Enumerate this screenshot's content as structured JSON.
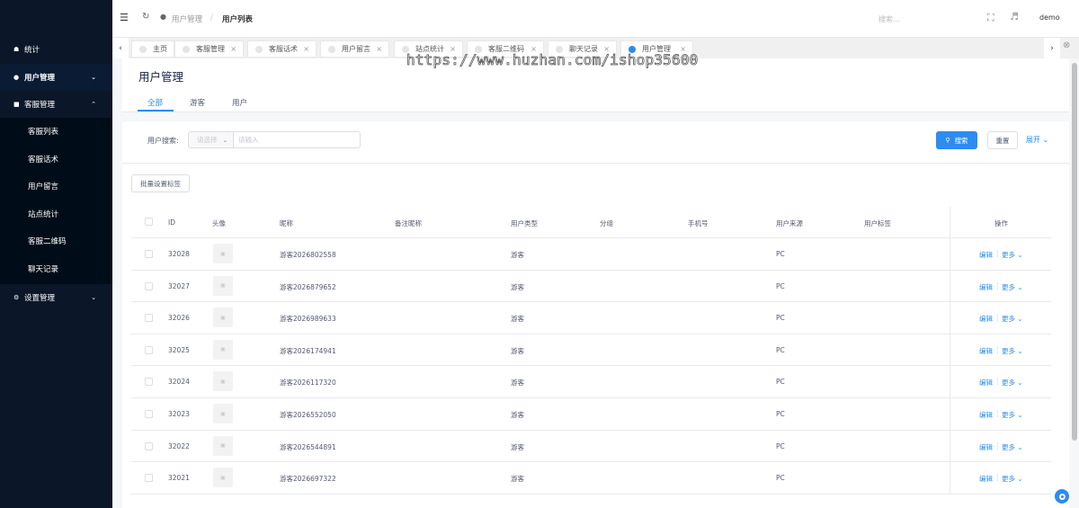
{
  "sidebar": {
    "items": [
      {
        "name": "sidebar-item-stats",
        "label": "统计",
        "icon": "home-icon"
      },
      {
        "name": "sidebar-item-users",
        "label": "用户管理",
        "icon": "user-icon"
      },
      {
        "name": "sidebar-item-service",
        "label": "客服管理",
        "icon": "chat-icon"
      }
    ],
    "sub_items": [
      "客服列表",
      "客服话术",
      "用户留言",
      "站点统计",
      "客服二维码",
      "聊天记录"
    ],
    "settings": {
      "label": "设置管理",
      "icon": "gear-icon"
    }
  },
  "header": {
    "breadcrumb_parent": "用户管理",
    "breadcrumb_sep": "/",
    "breadcrumb_current": "用户列表",
    "search_placeholder": "搜索...",
    "username": "demo"
  },
  "tabs": [
    {
      "label": "主页",
      "closable": false,
      "active": false
    },
    {
      "label": "客服管理",
      "closable": true,
      "active": false
    },
    {
      "label": "客服话术",
      "closable": true,
      "active": false
    },
    {
      "label": "用户留言",
      "closable": true,
      "active": false
    },
    {
      "label": "站点统计",
      "closable": true,
      "active": false
    },
    {
      "label": "客服二维码",
      "closable": true,
      "active": false
    },
    {
      "label": "聊天记录",
      "closable": true,
      "active": false
    },
    {
      "label": "用户管理",
      "closable": true,
      "active": true
    }
  ],
  "watermark": "https://www.huzhan.com/ishop35600",
  "page": {
    "title": "用户管理",
    "filter_tabs": [
      "全部",
      "游客",
      "用户"
    ],
    "active_filter": "全部"
  },
  "search": {
    "label": "用户搜索:",
    "select_placeholder": "请选择",
    "input_placeholder": "请输入",
    "search_button": "搜索",
    "reset_button": "重置",
    "expand": "展开"
  },
  "batch_button": "批量设置标签",
  "table": {
    "columns": [
      "ID",
      "头像",
      "昵称",
      "备注昵称",
      "用户类型",
      "分组",
      "手机号",
      "用户来源",
      "用户标签",
      "操作"
    ],
    "rows": [
      {
        "id": "32028",
        "nickname": "游客2026802558",
        "remark": "",
        "type": "游客",
        "group": "",
        "phone": "",
        "source": "PC",
        "tags": ""
      },
      {
        "id": "32027",
        "nickname": "游客2026879652",
        "remark": "",
        "type": "游客",
        "group": "",
        "phone": "",
        "source": "PC",
        "tags": ""
      },
      {
        "id": "32026",
        "nickname": "游客2026989633",
        "remark": "",
        "type": "游客",
        "group": "",
        "phone": "",
        "source": "PC",
        "tags": ""
      },
      {
        "id": "32025",
        "nickname": "游客2026174941",
        "remark": "",
        "type": "游客",
        "group": "",
        "phone": "",
        "source": "PC",
        "tags": ""
      },
      {
        "id": "32024",
        "nickname": "游客2026117320",
        "remark": "",
        "type": "游客",
        "group": "",
        "phone": "",
        "source": "PC",
        "tags": ""
      },
      {
        "id": "32023",
        "nickname": "游客2026552050",
        "remark": "",
        "type": "游客",
        "group": "",
        "phone": "",
        "source": "PC",
        "tags": ""
      },
      {
        "id": "32022",
        "nickname": "游客2026544891",
        "remark": "",
        "type": "游客",
        "group": "",
        "phone": "",
        "source": "PC",
        "tags": ""
      },
      {
        "id": "32021",
        "nickname": "游客2026697322",
        "remark": "",
        "type": "游客",
        "group": "",
        "phone": "",
        "source": "PC",
        "tags": ""
      }
    ],
    "edit_label": "编辑",
    "more_label": "更多"
  },
  "colors": {
    "sidebar_bg": "#0b1628",
    "accent": "#2d8cf0"
  }
}
